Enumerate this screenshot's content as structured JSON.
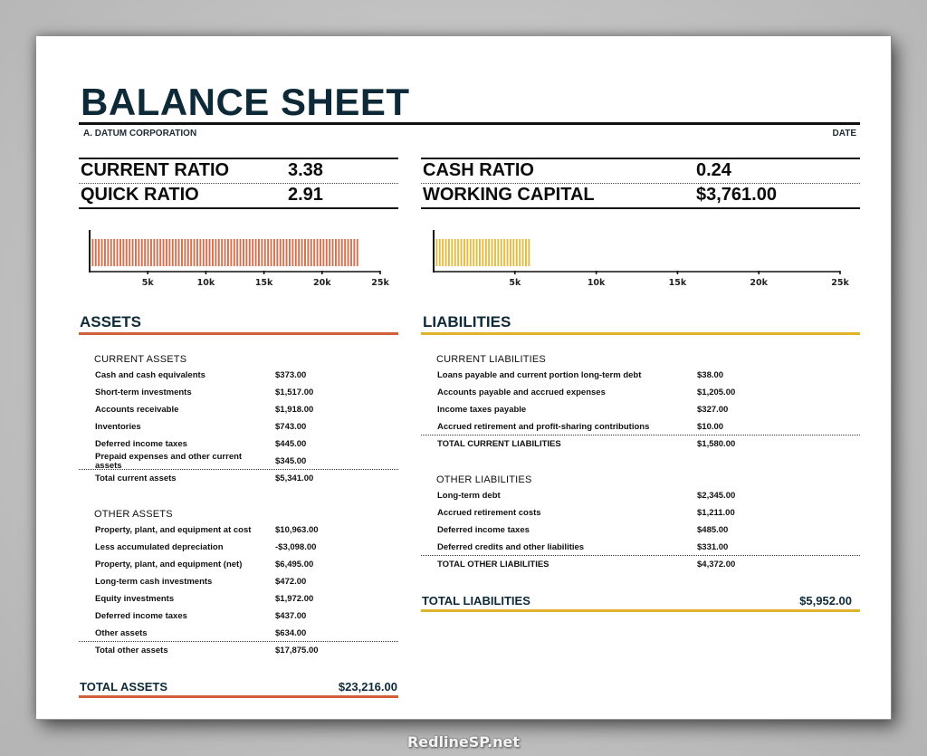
{
  "header": {
    "title": "BALANCE SHEET",
    "company": "A. DATUM CORPORATION",
    "date_label": "DATE"
  },
  "ratios": {
    "left": [
      {
        "label": "CURRENT RATIO",
        "value": "3.38"
      },
      {
        "label": "QUICK RATIO",
        "value": "2.91"
      }
    ],
    "right": [
      {
        "label": "CASH RATIO",
        "value": "0.24"
      },
      {
        "label": "WORKING CAPITAL",
        "value": "$3,761.00"
      }
    ]
  },
  "colors": {
    "assets_accent": "#d0603a",
    "liabilities_accent": "#e0b42a",
    "title": "#0e2a38"
  },
  "chart_data": [
    {
      "type": "bar",
      "orientation": "horizontal",
      "title": "",
      "categories": [
        "Total Assets"
      ],
      "values": [
        23216
      ],
      "xlim": [
        0,
        25000
      ],
      "xticks": [
        "5k",
        "10k",
        "15k",
        "20k",
        "25k"
      ],
      "xtick_values": [
        5000,
        10000,
        15000,
        20000,
        25000
      ],
      "color": "#d0603a",
      "pattern": "vertical-stripes"
    },
    {
      "type": "bar",
      "orientation": "horizontal",
      "title": "",
      "categories": [
        "Total Liabilities"
      ],
      "values": [
        5952
      ],
      "xlim": [
        0,
        25000
      ],
      "xticks": [
        "5k",
        "10k",
        "15k",
        "20k",
        "25k"
      ],
      "xtick_values": [
        5000,
        10000,
        15000,
        20000,
        25000
      ],
      "color": "#e0b42a",
      "pattern": "vertical-stripes"
    }
  ],
  "assets": {
    "title": "ASSETS",
    "current": {
      "title": "CURRENT ASSETS",
      "items": [
        {
          "label": "Cash and cash equivalents",
          "value": "$373.00"
        },
        {
          "label": "Short-term investments",
          "value": "$1,517.00"
        },
        {
          "label": "Accounts receivable",
          "value": "$1,918.00"
        },
        {
          "label": "Inventories",
          "value": "$743.00"
        },
        {
          "label": "Deferred income taxes",
          "value": "$445.00"
        },
        {
          "label": "Prepaid expenses and other current assets",
          "value": "$345.00"
        }
      ],
      "total_label": "Total current assets",
      "total_value": "$5,341.00"
    },
    "other": {
      "title": "OTHER ASSETS",
      "items": [
        {
          "label": "Property, plant, and equipment at cost",
          "value": "$10,963.00"
        },
        {
          "label": "Less accumulated depreciation",
          "value": "-$3,098.00"
        },
        {
          "label": "Property, plant, and equipment (net)",
          "value": "$6,495.00"
        },
        {
          "label": "Long-term cash investments",
          "value": "$472.00"
        },
        {
          "label": "Equity investments",
          "value": "$1,972.00"
        },
        {
          "label": "Deferred income taxes",
          "value": "$437.00"
        },
        {
          "label": "Other assets",
          "value": "$634.00"
        }
      ],
      "total_label": "Total other assets",
      "total_value": "$17,875.00"
    },
    "total_label": "TOTAL ASSETS",
    "total_value": "$23,216.00"
  },
  "liabilities": {
    "title": "LIABILITIES",
    "current": {
      "title": "CURRENT LIABILITIES",
      "items": [
        {
          "label": "Loans payable and current portion long-term debt",
          "value": "$38.00"
        },
        {
          "label": "Accounts payable and accrued expenses",
          "value": "$1,205.00"
        },
        {
          "label": "Income taxes payable",
          "value": "$327.00"
        },
        {
          "label": "Accrued retirement and profit-sharing contributions",
          "value": "$10.00"
        }
      ],
      "total_label": "TOTAL CURRENT LIABILITIES",
      "total_value": "$1,580.00"
    },
    "other": {
      "title": "OTHER LIABILITIES",
      "items": [
        {
          "label": "Long-term debt",
          "value": "$2,345.00"
        },
        {
          "label": "Accrued retirement costs",
          "value": "$1,211.00"
        },
        {
          "label": "Deferred income taxes",
          "value": "$485.00"
        },
        {
          "label": "Deferred credits and other liabilities",
          "value": "$331.00"
        }
      ],
      "total_label": "TOTAL OTHER LIABILITIES",
      "total_value": "$4,372.00"
    },
    "total_label": "TOTAL LIABILITIES",
    "total_value": "$5,952.00"
  },
  "watermark": "RedlineSP.net"
}
